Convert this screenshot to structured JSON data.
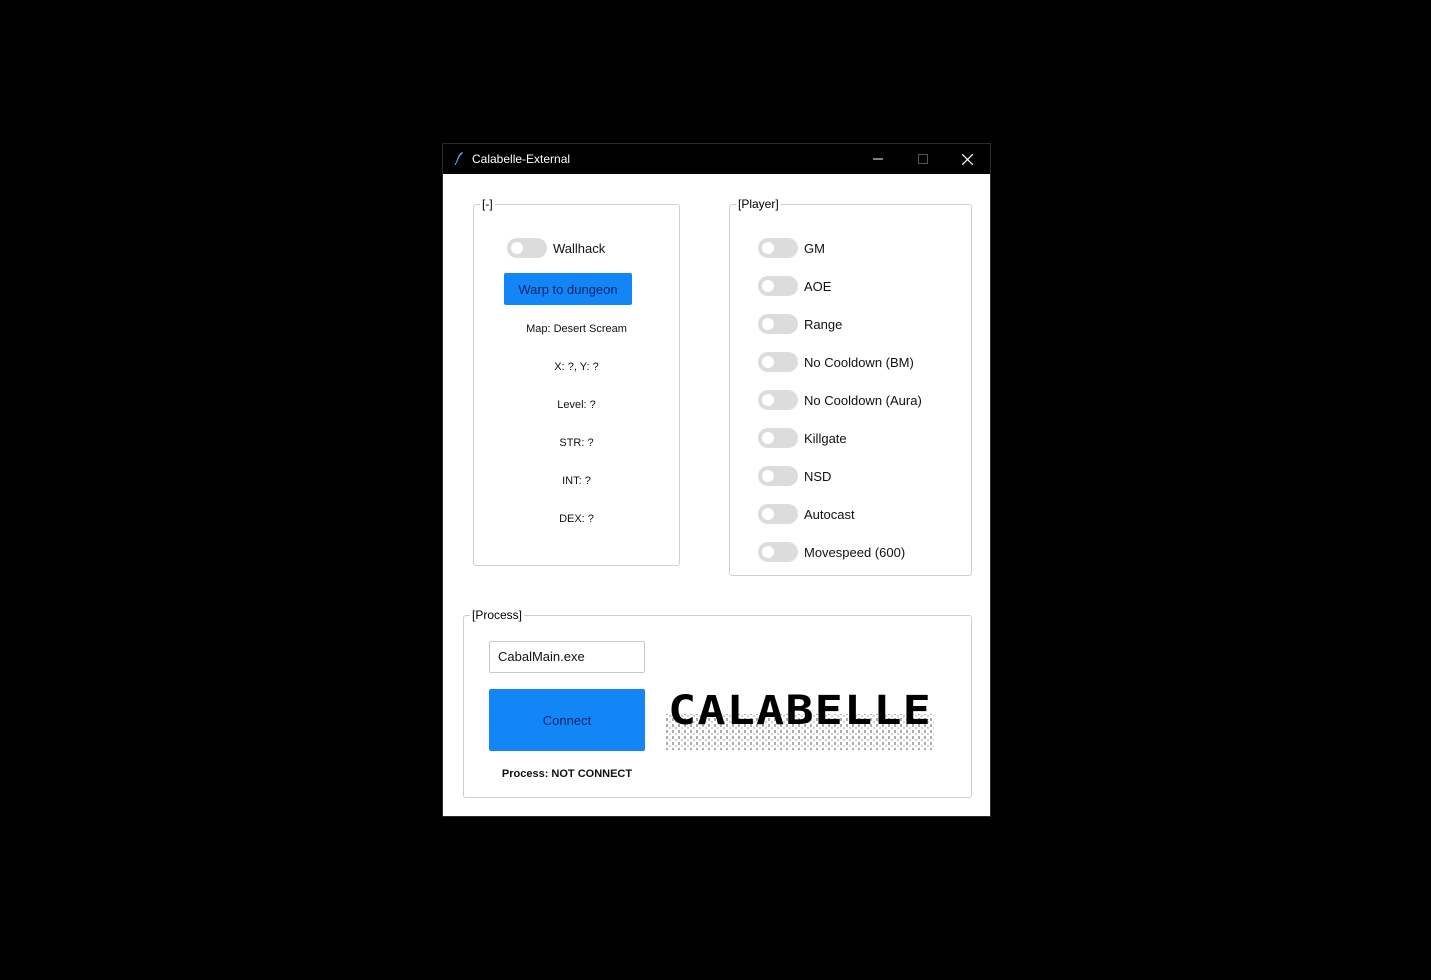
{
  "window": {
    "title": "Calabelle-External"
  },
  "left_group": {
    "legend": "[-]",
    "wallhack_label": "Wallhack",
    "warp_button": "Warp to dungeon",
    "map": "Map: Desert Scream",
    "coords": "X: ?, Y: ?",
    "level": "Level: ?",
    "str": "STR: ?",
    "int": "INT: ?",
    "dex": "DEX: ?"
  },
  "player_group": {
    "legend": "[Player]",
    "toggles": [
      {
        "label": "GM",
        "on": false
      },
      {
        "label": "AOE",
        "on": false
      },
      {
        "label": "Range",
        "on": false
      },
      {
        "label": "No Cooldown (BM)",
        "on": false
      },
      {
        "label": "No Cooldown (Aura)",
        "on": false
      },
      {
        "label": "Killgate",
        "on": false
      },
      {
        "label": "NSD",
        "on": false
      },
      {
        "label": "Autocast",
        "on": false
      },
      {
        "label": "Movespeed (600)",
        "on": false
      }
    ]
  },
  "process_group": {
    "legend": "[Process]",
    "process_name": "CabalMain.exe",
    "connect_button": "Connect",
    "status": "Process: NOT CONNECT",
    "logo_text": "CALABELLE"
  },
  "colors": {
    "accent": "#1286f7",
    "titlebar": "#000000",
    "toggle_off": "#dcdcdc"
  }
}
